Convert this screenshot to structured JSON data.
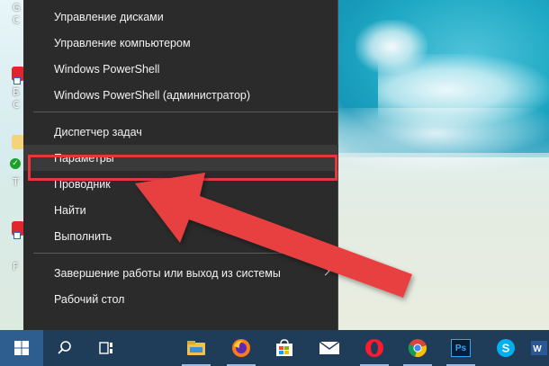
{
  "menu": {
    "items": [
      {
        "id": "disk-management",
        "label": "Управление дисками",
        "separator_after": false,
        "submenu": false,
        "highlighted": false
      },
      {
        "id": "computer-management",
        "label": "Управление компьютером",
        "separator_after": false,
        "submenu": false,
        "highlighted": false
      },
      {
        "id": "powershell",
        "label": "Windows PowerShell",
        "separator_after": false,
        "submenu": false,
        "highlighted": false
      },
      {
        "id": "powershell-admin",
        "label": "Windows PowerShell (администратор)",
        "separator_after": true,
        "submenu": false,
        "highlighted": false
      },
      {
        "id": "task-manager",
        "label": "Диспетчер задач",
        "separator_after": false,
        "submenu": false,
        "highlighted": false
      },
      {
        "id": "settings",
        "label": "Параметры",
        "separator_after": false,
        "submenu": false,
        "highlighted": true
      },
      {
        "id": "explorer",
        "label": "Проводник",
        "separator_after": false,
        "submenu": false,
        "highlighted": false
      },
      {
        "id": "search",
        "label": "Найти",
        "separator_after": false,
        "submenu": false,
        "highlighted": false
      },
      {
        "id": "run",
        "label": "Выполнить",
        "separator_after": true,
        "submenu": false,
        "highlighted": false
      },
      {
        "id": "shutdown",
        "label": "Завершение работы или выход из системы",
        "separator_after": false,
        "submenu": true,
        "highlighted": false
      },
      {
        "id": "desktop",
        "label": "Рабочий стол",
        "separator_after": false,
        "submenu": false,
        "highlighted": false
      }
    ]
  },
  "desktop": {
    "edge_letters": [
      "G",
      "C",
      "Б",
      "C",
      "T",
      "F"
    ]
  },
  "taskbar": {
    "icons": [
      {
        "id": "start",
        "name": "windows-start-icon"
      },
      {
        "id": "search",
        "name": "search-icon"
      },
      {
        "id": "taskview",
        "name": "task-view-icon"
      },
      {
        "id": "explorer",
        "name": "file-explorer-icon"
      },
      {
        "id": "firefox",
        "name": "firefox-icon"
      },
      {
        "id": "store",
        "name": "store-icon"
      },
      {
        "id": "mail",
        "name": "mail-icon"
      },
      {
        "id": "opera",
        "name": "opera-icon"
      },
      {
        "id": "chrome",
        "name": "chrome-icon"
      },
      {
        "id": "photoshop",
        "name": "photoshop-icon",
        "label": "Ps"
      },
      {
        "id": "skype",
        "name": "skype-icon"
      },
      {
        "id": "word",
        "name": "word-icon"
      }
    ]
  },
  "colors": {
    "menu_bg": "#2b2b2b",
    "highlight_border": "#e3393e",
    "arrow": "#e8403f",
    "taskbar_bg": "#1f3c59"
  }
}
